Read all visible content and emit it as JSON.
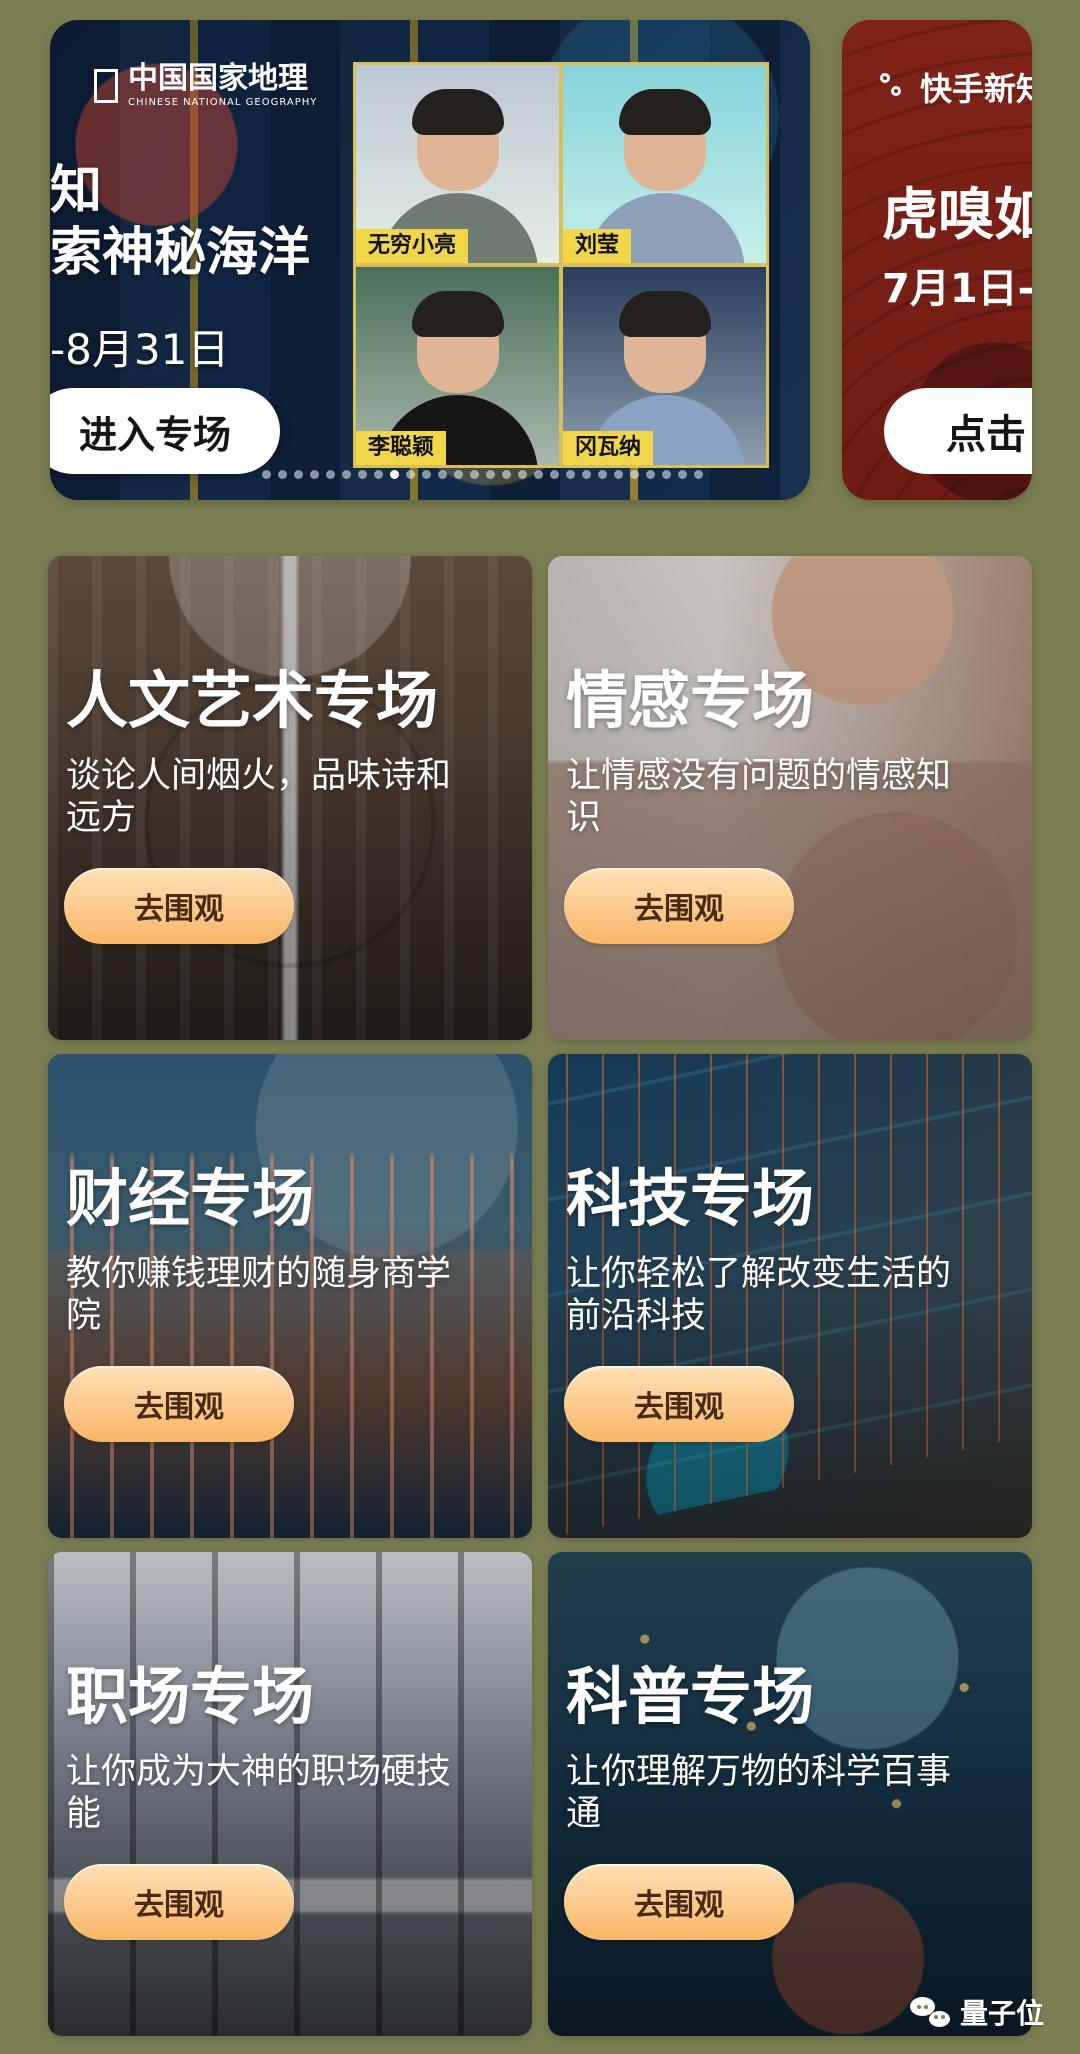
{
  "carousel": {
    "main": {
      "brand_name": "中国国家地理",
      "brand_english": "CHINESE NATIONAL GEOGRAPHY",
      "headline_1": "知",
      "headline_2": "索神秘海洋",
      "date": "-8月31日",
      "button": "进入专场",
      "people": [
        "无穷小亮",
        "刘莹",
        "李聪颖",
        "冈瓦纳"
      ]
    },
    "secondary": {
      "brand": "快手新知",
      "title": "虎嗅如",
      "date": "7月1日-",
      "button": "点击"
    },
    "active_dot": 8
  },
  "cards": [
    {
      "title": "人文艺术专场",
      "subtitle": "谈论人间烟火，品味诗和远方",
      "button": "去围观"
    },
    {
      "title": "情感专场",
      "subtitle": "让情感没有问题的情感知识",
      "button": "去围观"
    },
    {
      "title": "财经专场",
      "subtitle": "教你赚钱理财的随身商学院",
      "button": "去围观"
    },
    {
      "title": "科技专场",
      "subtitle": "让你轻松了解改变生活的前沿科技",
      "button": "去围观"
    },
    {
      "title": "职场专场",
      "subtitle": "让你成为大神的职场硬技能",
      "button": "去围观"
    },
    {
      "title": "科普专场",
      "subtitle": "让你理解万物的科学百事通",
      "button": "去围观"
    }
  ],
  "watermark": "量子位",
  "colors": {
    "background": "#7b7d52",
    "button_gradient_top": "#ffe1b7",
    "button_gradient_bottom": "#f8b566",
    "name_tag": "#f1d54b"
  },
  "icons": {
    "brand": "square-outline-icon",
    "secondary_brand": "connection-icon",
    "watermark": "wechat-icon"
  }
}
